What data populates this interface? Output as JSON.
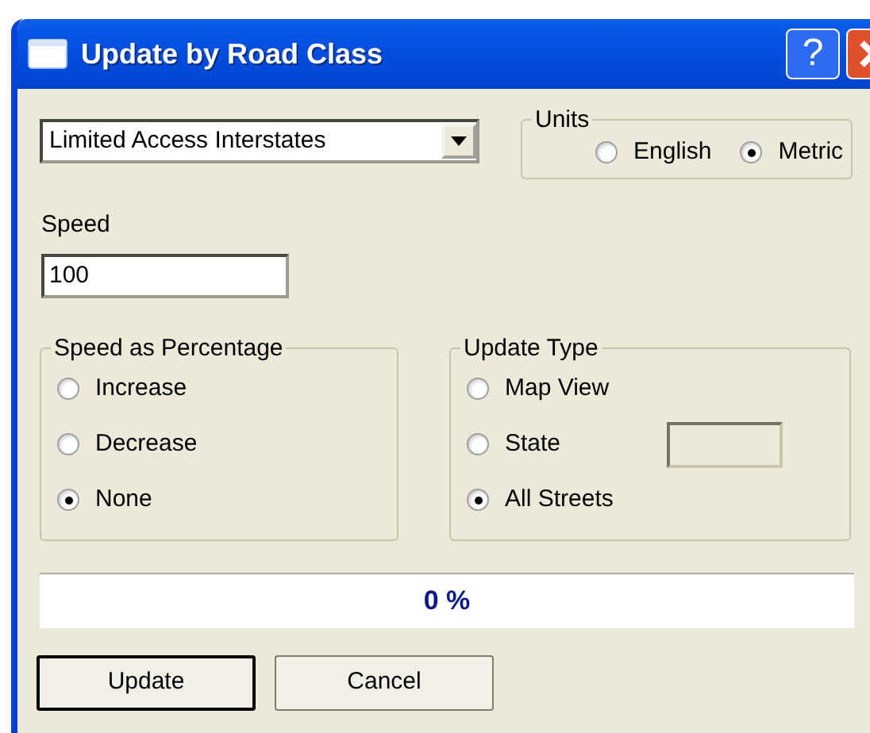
{
  "window": {
    "title": "Update by Road Class",
    "help_button": "?"
  },
  "road_class": {
    "value": "Limited Access Interstates"
  },
  "units": {
    "title": "Units",
    "options": [
      {
        "label": "English",
        "selected": false
      },
      {
        "label": "Metric",
        "selected": true
      }
    ]
  },
  "speed": {
    "label": "Speed",
    "value": "100"
  },
  "speed_as_percentage": {
    "title": "Speed as Percentage",
    "options": [
      {
        "label": "Increase",
        "selected": false,
        "kind": "plain"
      },
      {
        "label": "Decrease",
        "selected": false,
        "kind": "plain"
      },
      {
        "label": "None",
        "selected": true,
        "kind": "plain"
      }
    ]
  },
  "update_type": {
    "title": "Update Type",
    "options": [
      {
        "label": "Map View",
        "selected": false,
        "kind": "plain"
      },
      {
        "label": "State",
        "selected": false,
        "kind": "with_field"
      },
      {
        "label": "All Streets",
        "selected": true,
        "kind": "plain"
      }
    ]
  },
  "progress": {
    "level": 0,
    "reading": "0 %"
  },
  "buttons": [
    {
      "label": "Update",
      "default": true
    },
    {
      "label": "Cancel",
      "default": false
    }
  ]
}
